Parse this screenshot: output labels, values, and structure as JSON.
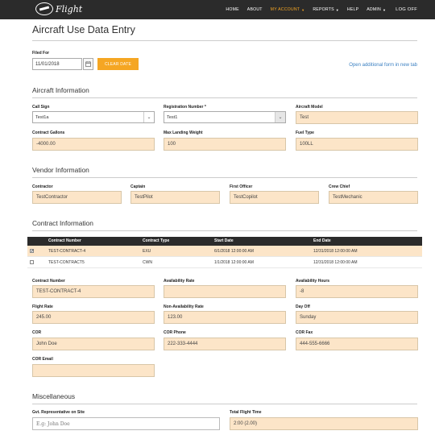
{
  "nav": {
    "brand": "Flight",
    "items": [
      "HOME",
      "ABOUT",
      "MY ACCOUNT",
      "REPORTS",
      "HELP",
      "ADMIN",
      "LOG OFF"
    ]
  },
  "page": {
    "title": "Aircraft Use Data Entry",
    "filed_for_label": "Filed For",
    "filed_for_value": "11/01/2018",
    "clear_label": "CLEAR DATE",
    "open_link": "Open additional form in new tab"
  },
  "aircraft": {
    "heading": "Aircraft Information",
    "call_sign_label": "Call Sign",
    "call_sign_value": "Test1a",
    "registration_label": "Registration Number *",
    "registration_value": "Test1",
    "model_label": "Aircraft Model",
    "model_value": "Test",
    "gallons_label": "Contract Gallons",
    "gallons_value": "-4000.00",
    "max_landing_label": "Max Landing Weight",
    "max_landing_value": "100",
    "fuel_label": "Fuel Type",
    "fuel_value": "100LL"
  },
  "vendor": {
    "heading": "Vendor Information",
    "contractor_label": "Contractor",
    "contractor_value": "TestContractor",
    "captain_label": "Captain",
    "captain_value": "TestPilot",
    "first_officer_label": "First Officer",
    "first_officer_value": "TestCopilot",
    "crew_chief_label": "Crew Chief",
    "crew_chief_value": "TestMechanic"
  },
  "contract": {
    "heading": "Contract Information",
    "columns": [
      "Contract Number",
      "Contract Type",
      "Start Date",
      "End Date"
    ],
    "rows": [
      {
        "check": "✔",
        "number": "TEST-CONTRACT-4",
        "type": "EXU",
        "start": "6/1/2018 12:00:00 AM",
        "end": "12/31/2018 12:00:00 AM"
      },
      {
        "check": "",
        "number": "TEST-CONTRACT5",
        "type": "CWN",
        "start": "1/1/2018 12:00:00 AM",
        "end": "12/31/2018 12:00:00 AM"
      }
    ],
    "number_label": "Contract Number",
    "number_value": "TEST-CONTRACT-4",
    "availability_rate_label": "Availability Rate",
    "availability_rate_value": "",
    "availability_hours_label": "Availability Hours",
    "availability_hours_value": "-8",
    "flight_rate_label": "Flight Rate",
    "flight_rate_value": "245.00",
    "non_avail_label": "Non-Availability Rate",
    "non_avail_value": "123.00",
    "day_off_label": "Day Off",
    "day_off_value": "Sunday",
    "cor_label": "COR",
    "cor_value": "John Doe",
    "cor_phone_label": "COR Phone",
    "cor_phone_value": "222-333-4444",
    "cor_fax_label": "COR Fax",
    "cor_fax_value": "444-555-6666",
    "cor_email_label": "COR Email",
    "cor_email_value": ""
  },
  "misc": {
    "heading": "Miscellaneous",
    "gov_rep_label": "Gvt. Representative on Site",
    "gov_rep_placeholder": "E.g: John Doe",
    "total_flight_label": "Total Flight Time",
    "total_flight_value": "2:00 (2.00)"
  },
  "colors": {
    "nav_bg": "#2b2b2b",
    "accent": "#f5a623",
    "field_bg": "#fce5c8",
    "link": "#3a7fc1"
  }
}
